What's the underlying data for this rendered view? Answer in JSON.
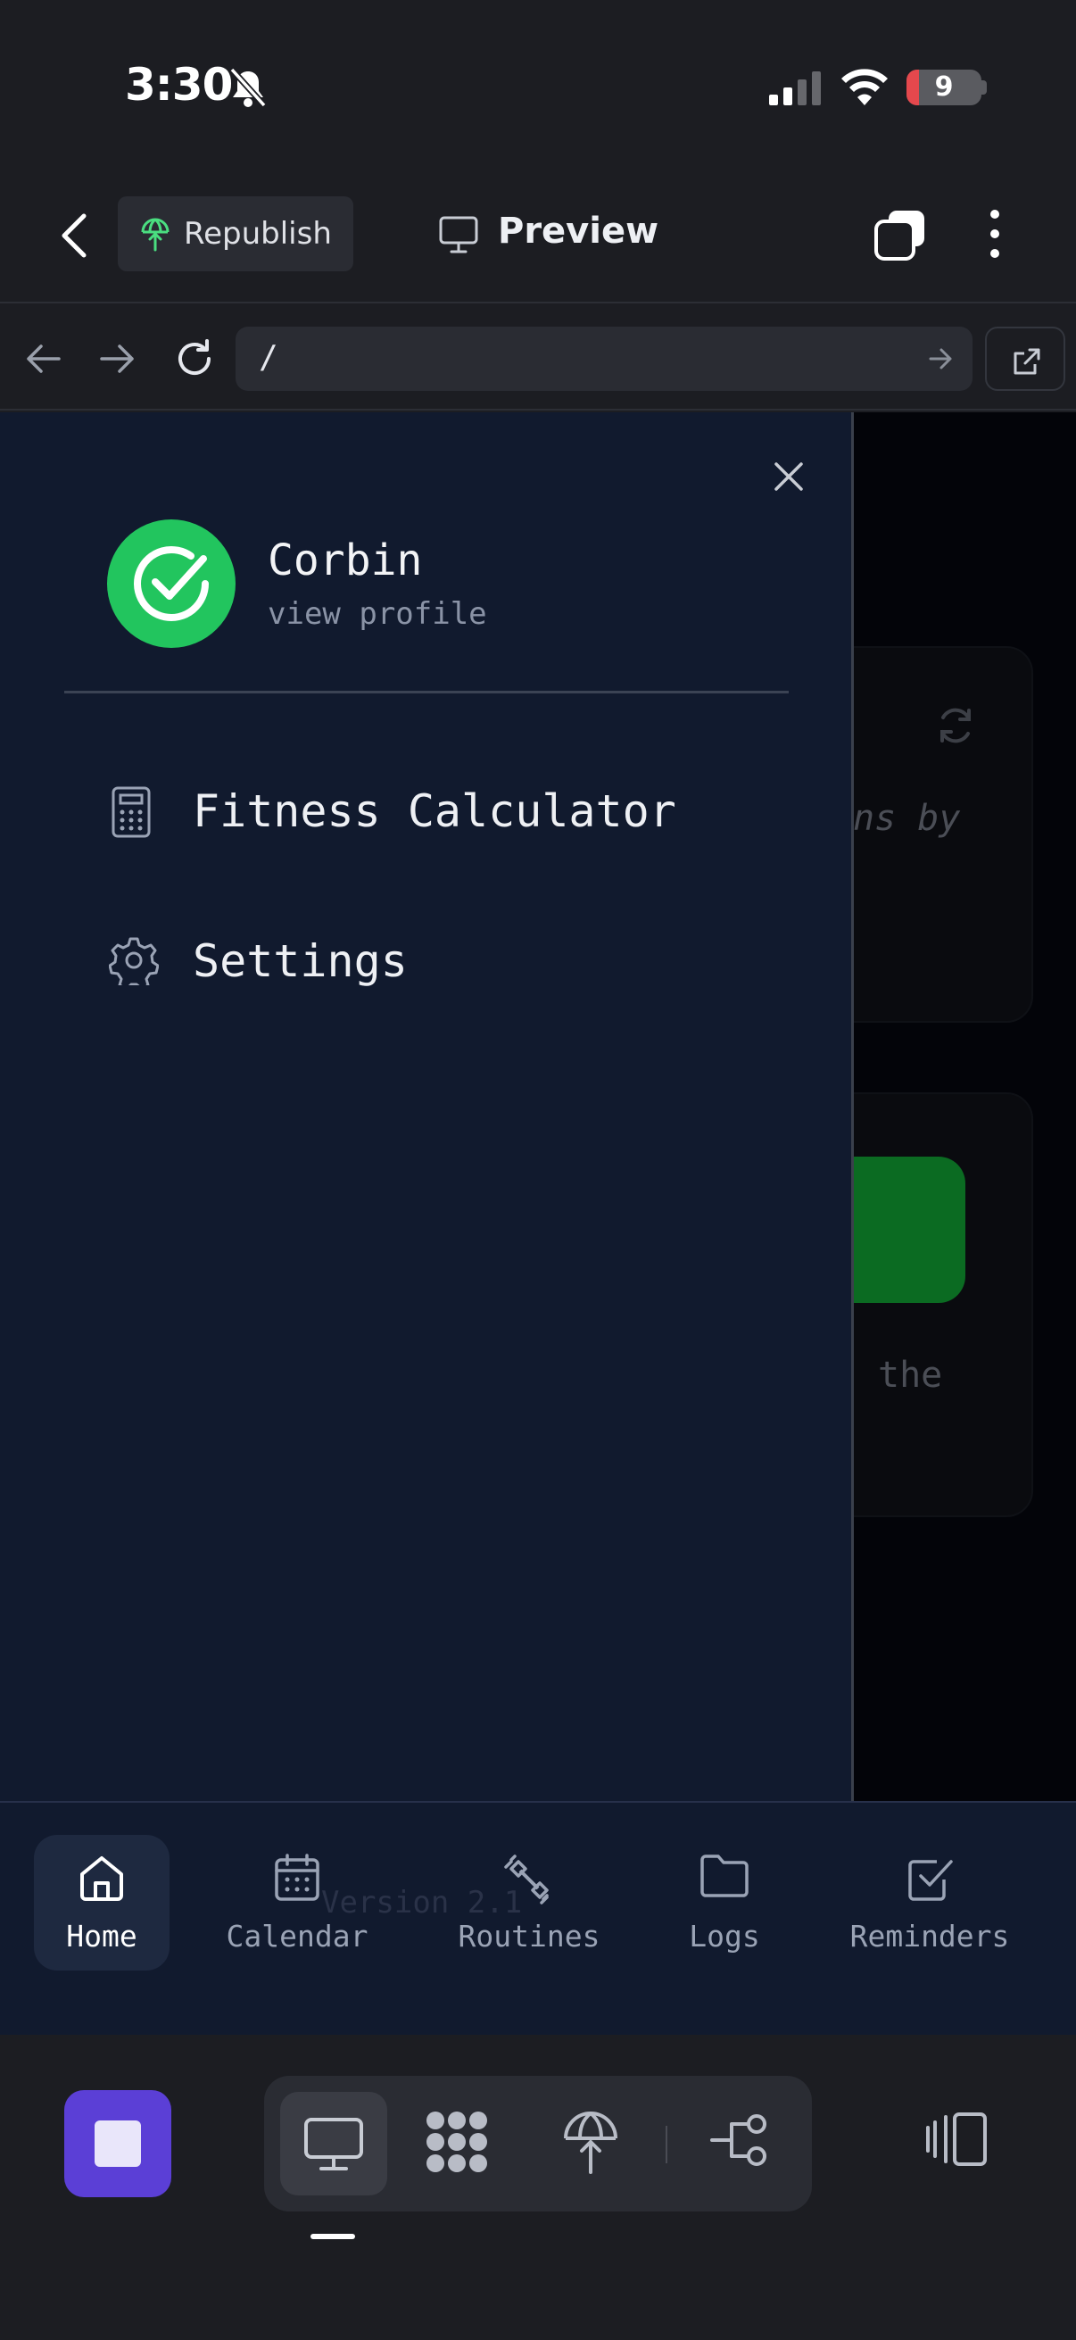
{
  "status_bar": {
    "time": "3:30",
    "battery": "9"
  },
  "top_bar": {
    "republish_label": "Republish",
    "preview_label": "Preview"
  },
  "url_bar": {
    "url": "/"
  },
  "background_app": {
    "snippet_1": "ns by",
    "snippet_2": "the",
    "version_ghost": "Version 2.1"
  },
  "drawer": {
    "profile": {
      "name": "Corbin",
      "subtitle": "view profile"
    },
    "items": [
      {
        "label": "Fitness Calculator",
        "icon": "calculator-icon"
      },
      {
        "label": "Settings",
        "icon": "gear-icon"
      }
    ]
  },
  "tabbar": {
    "tabs": [
      {
        "label": "Home",
        "icon": "home-icon",
        "active": true
      },
      {
        "label": "Calendar",
        "icon": "calendar-icon"
      },
      {
        "label": "Routines",
        "icon": "dumbbell-icon"
      },
      {
        "label": "Logs",
        "icon": "folder-icon"
      },
      {
        "label": "Reminders",
        "icon": "checkbox-icon"
      }
    ]
  },
  "colors": {
    "drawer_bg": "#111a2e",
    "avatar_green": "#22c55e",
    "stop_button": "#5b3fd6",
    "battery_low": "#e5484d"
  }
}
